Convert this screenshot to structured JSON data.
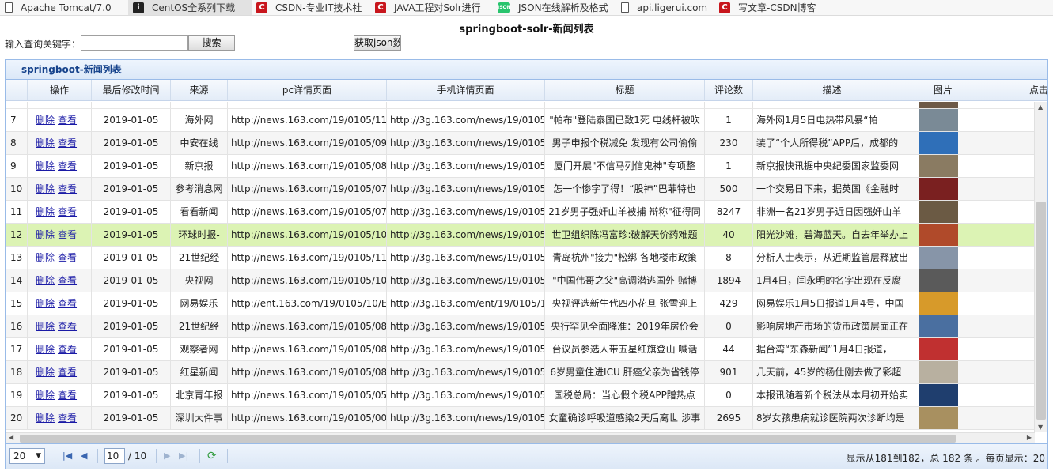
{
  "bookmarks": [
    {
      "label": "Apache Tomcat/7.0",
      "icon": "doc"
    },
    {
      "label": "CentOS全系列下载",
      "icon": "centos"
    },
    {
      "label": "CSDN-专业IT技术社",
      "icon": "csdn"
    },
    {
      "label": "JAVA工程对Solr进行",
      "icon": "csdn"
    },
    {
      "label": "JSON在线解析及格式",
      "icon": "json"
    },
    {
      "label": "api.ligerui.com",
      "icon": "doc"
    },
    {
      "label": "写文章-CSDN博客",
      "icon": "csdn"
    }
  ],
  "page": {
    "title": "springboot-solr-新闻列表"
  },
  "search": {
    "label": "输入查询关键字：",
    "value": "",
    "button": "搜索",
    "json_button": "获取json数"
  },
  "grid": {
    "title": "springboot-新闻列表",
    "columns": [
      "",
      "操作",
      "最后修改时间",
      "来源",
      "pc详情页面",
      "手机详情页面",
      "标题",
      "评论数",
      "描述",
      "图片",
      "点击"
    ],
    "rows": [
      {
        "n": "7",
        "del": "删除",
        "view": "查看",
        "date": "2019-01-05",
        "source": "海外网",
        "pc": "http://news.163.com/19/0105/11,",
        "mobile": "http://3g.163.com/news/19/0105,",
        "title": "\"帕布\"登陆泰国已致1死 电线杆被吹",
        "comments": "1",
        "desc": "海外网1月5日电热带风暴“帕",
        "thumb": "#7a8a96"
      },
      {
        "n": "8",
        "del": "删除",
        "view": "查看",
        "date": "2019-01-05",
        "source": "中安在线",
        "pc": "http://news.163.com/19/0105/09,",
        "mobile": "http://3g.163.com/news/19/0105,",
        "title": "男子申报个税减免 发现有公司偷偷",
        "comments": "230",
        "desc": "装了“个人所得税”APP后，成都的",
        "thumb": "#2f6fb8"
      },
      {
        "n": "9",
        "del": "删除",
        "view": "查看",
        "date": "2019-01-05",
        "source": "新京报",
        "pc": "http://news.163.com/19/0105/08,",
        "mobile": "http://3g.163.com/news/19/0105,",
        "title": "厦门开展\"不信马列信鬼神\"专项整",
        "comments": "1",
        "desc": "新京报快讯据中央纪委国家监委网",
        "thumb": "#8a7b62"
      },
      {
        "n": "10",
        "del": "删除",
        "view": "查看",
        "date": "2019-01-05",
        "source": "参考消息网",
        "pc": "http://news.163.com/19/0105/07,",
        "mobile": "http://3g.163.com/news/19/0105,",
        "title": "怎一个惨字了得！“股神”巴菲特也",
        "comments": "500",
        "desc": "一个交易日下来，据英国《金融时",
        "thumb": "#7a2020"
      },
      {
        "n": "11",
        "del": "删除",
        "view": "查看",
        "date": "2019-01-05",
        "source": "看看新闻",
        "pc": "http://news.163.com/19/0105/07,",
        "mobile": "http://3g.163.com/news/19/0105,",
        "title": "21岁男子强奸山羊被捕 辩称\"征得同",
        "comments": "8247",
        "desc": "非洲一名21岁男子近日因强奸山羊",
        "thumb": "#6b5a44"
      },
      {
        "n": "12",
        "del": "删除",
        "view": "查看",
        "date": "2019-01-05",
        "source": "环球时报-",
        "pc": "http://news.163.com/19/0105/10,",
        "mobile": "http://3g.163.com/news/19/0105,",
        "title": "世卫组织陈冯富珍:破解天价药难题",
        "comments": "40",
        "desc": "阳光沙滩，碧海蓝天。自去年举办上",
        "thumb": "#b04a2a"
      },
      {
        "n": "13",
        "del": "删除",
        "view": "查看",
        "date": "2019-01-05",
        "source": "21世纪经",
        "pc": "http://news.163.com/19/0105/11,",
        "mobile": "http://3g.163.com/news/19/0105,",
        "title": "青岛杭州\"接力\"松绑 各地楼市政策",
        "comments": "8",
        "desc": "分析人士表示，从近期监管层释放出",
        "thumb": "#8795a8"
      },
      {
        "n": "14",
        "del": "删除",
        "view": "查看",
        "date": "2019-01-05",
        "source": "央视网",
        "pc": "http://news.163.com/19/0105/10,",
        "mobile": "http://3g.163.com/news/19/0105,",
        "title": "\"中国伟哥之父\"高调潜逃国外 赌博",
        "comments": "1894",
        "desc": "1月4日，闫永明的名字出现在反腐",
        "thumb": "#5a5a5a"
      },
      {
        "n": "15",
        "del": "删除",
        "view": "查看",
        "date": "2019-01-05",
        "source": "网易娱乐",
        "pc": "http://ent.163.com/19/0105/10/E",
        "mobile": "http://3g.163.com/ent/19/0105/1",
        "title": "央视评选新生代四小花旦 张雪迎上",
        "comments": "429",
        "desc": "网易娱乐1月5日报道1月4号，中国",
        "thumb": "#d79a2a"
      },
      {
        "n": "16",
        "del": "删除",
        "view": "查看",
        "date": "2019-01-05",
        "source": "21世纪经",
        "pc": "http://news.163.com/19/0105/08,",
        "mobile": "http://3g.163.com/news/19/0105,",
        "title": "央行罕见全面降准：2019年房价会",
        "comments": "0",
        "desc": "影响房地产市场的货币政策层面正在",
        "thumb": "#4a6fa0"
      },
      {
        "n": "17",
        "del": "删除",
        "view": "查看",
        "date": "2019-01-05",
        "source": "观察者网",
        "pc": "http://news.163.com/19/0105/08,",
        "mobile": "http://3g.163.com/news/19/0105,",
        "title": "台议员参选人带五星红旗登山 喊话",
        "comments": "44",
        "desc": "据台湾“东森新闻”1月4日报道，",
        "thumb": "#c03030"
      },
      {
        "n": "18",
        "del": "删除",
        "view": "查看",
        "date": "2019-01-05",
        "source": "红星新闻",
        "pc": "http://news.163.com/19/0105/08,",
        "mobile": "http://3g.163.com/news/19/0105,",
        "title": "6岁男童住进ICU 肝癌父亲为省钱停",
        "comments": "901",
        "desc": "几天前，45岁的杨仕刚去做了彩超",
        "thumb": "#b8b0a0"
      },
      {
        "n": "19",
        "del": "删除",
        "view": "查看",
        "date": "2019-01-05",
        "source": "北京青年报",
        "pc": "http://news.163.com/19/0105/05,",
        "mobile": "http://3g.163.com/news/19/0105,",
        "title": "国税总局：当心假个税APP蹭热点",
        "comments": "0",
        "desc": "本报讯随着新个税法从本月初开始实",
        "thumb": "#1f3e6e"
      },
      {
        "n": "20",
        "del": "删除",
        "view": "查看",
        "date": "2019-01-05",
        "source": "深圳大件事",
        "pc": "http://news.163.com/19/0105/00,",
        "mobile": "http://3g.163.com/news/19/0105,",
        "title": "女童确诊呼吸道感染2天后离世 涉事",
        "comments": "2695",
        "desc": "8岁女孩患病就诊医院两次诊断均是",
        "thumb": "#a89060"
      }
    ]
  },
  "pager": {
    "page_size": "20",
    "current_page": "10",
    "total_pages": "/ 10",
    "info": "显示从181到182，总 182 条 。每页显示：20"
  }
}
